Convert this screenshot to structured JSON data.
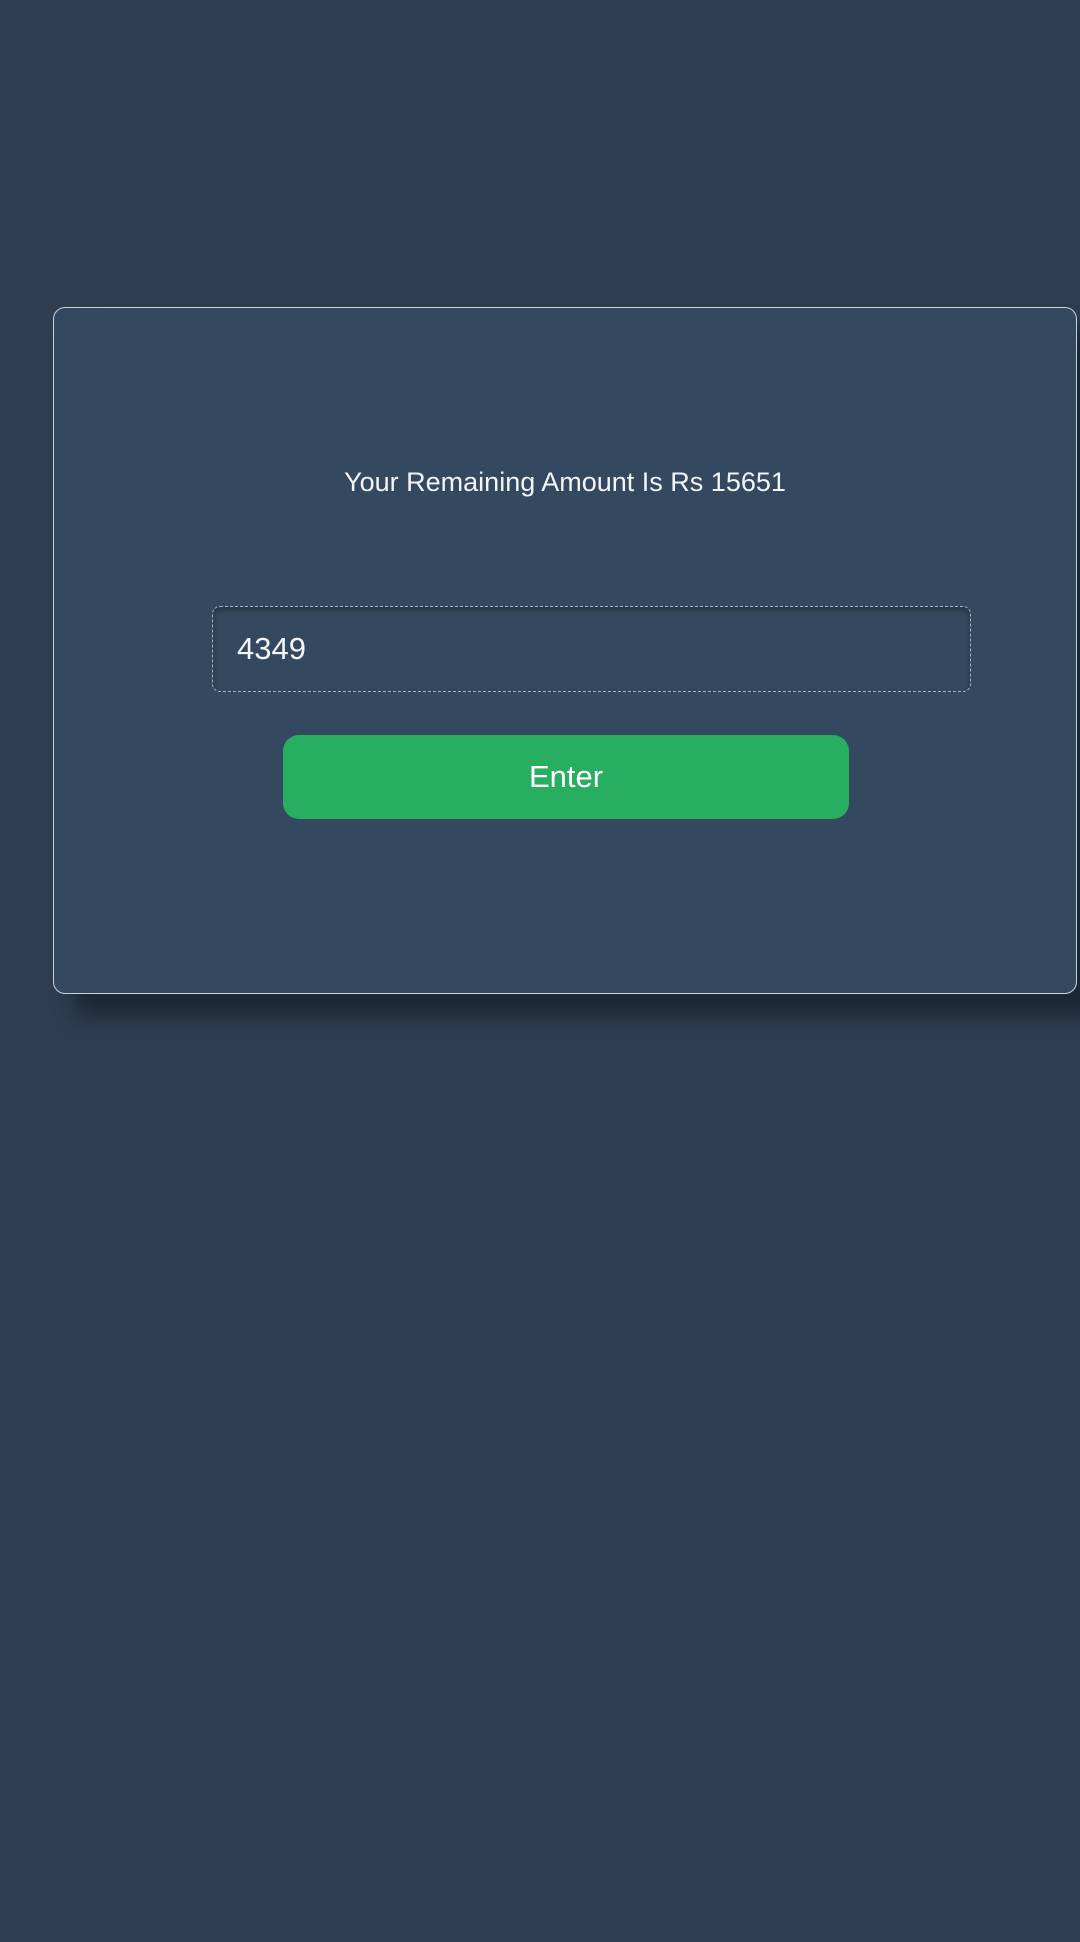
{
  "card": {
    "title": "Your Remaining Amount Is Rs 15651"
  },
  "amount_input": {
    "value": "4349"
  },
  "enter_button": {
    "label": "Enter"
  },
  "colors": {
    "background": "#2e3d50",
    "card": "#34495f",
    "button": "#27ae60",
    "text": "#f2f5f8"
  }
}
